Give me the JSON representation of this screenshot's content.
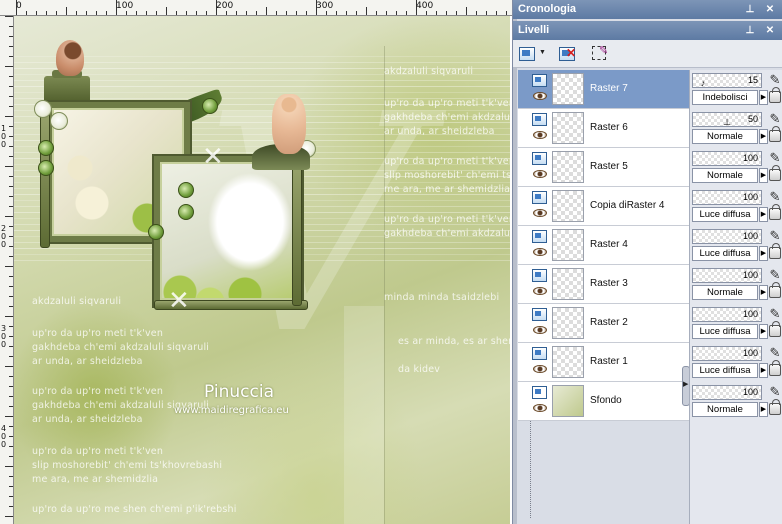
{
  "ruler_top": {
    "labels": [
      "0",
      "100",
      "200",
      "300",
      "400"
    ]
  },
  "ruler_left": {
    "labels": [
      "1",
      "0",
      "0",
      "2",
      "0",
      "0",
      "3",
      "0",
      "0",
      "4",
      "0",
      "0"
    ]
  },
  "canvas": {
    "text_lines": [
      "akdzaluli siqvaruli",
      "up'ro da up'ro meti t'k'ven",
      "gakhdeba ch'emi akdzaluli siqvaruli",
      "ar unda, ar sheidzleba",
      "up'ro da up'ro meti t'k'ven",
      "slip moshorebit' ch'emi ts'khovrebashi",
      "me ara, me ar shemidzlia",
      "da kidev",
      "up'ro da up'ro meti t'k'ven",
      "gakhdeba ch'emi akdzaluli siqvaruli",
      "minda minda tsaidzlebi",
      "es ar minda, es ar shemidzlia",
      "up'ro da up'ro meti t'k'ven",
      "slip moshorebit' ch'emi ts'khovrebashi",
      "me ara, me ar shemidzlia",
      "up'ro da up'ro me shen ch'emi p'ik'rebshi"
    ],
    "signature": "Pinuccia",
    "website": "www.maidiregrafica.eu"
  },
  "panels": {
    "history_title": "Cronologia",
    "layers_title": "Livelli"
  },
  "layers": [
    {
      "name": "Raster 7",
      "selected": true
    },
    {
      "name": "Raster 6"
    },
    {
      "name": "Raster 5"
    },
    {
      "name": "Copia diRaster 4"
    },
    {
      "name": "Raster 4"
    },
    {
      "name": "Raster 3"
    },
    {
      "name": "Raster 2"
    },
    {
      "name": "Raster 1"
    },
    {
      "name": "Sfondo"
    }
  ],
  "layer_props": [
    {
      "opacity": "15",
      "blend": "Indebolisci"
    },
    {
      "opacity": "50",
      "blend": "Normale"
    },
    {
      "opacity": "100",
      "blend": "Normale"
    },
    {
      "opacity": "100",
      "blend": "Luce diffusa"
    },
    {
      "opacity": "100",
      "blend": "Luce diffusa"
    },
    {
      "opacity": "100",
      "blend": "Normale"
    },
    {
      "opacity": "100",
      "blend": "Luce diffusa"
    },
    {
      "opacity": "100",
      "blend": "Luce diffusa"
    },
    {
      "opacity": "100",
      "blend": "Normale"
    }
  ],
  "colors": {
    "panel_title": "#5d7aa3",
    "selected_layer": "#7b9ac8"
  },
  "icons": {
    "history_pin": "pin-icon",
    "history_close": "close-icon",
    "layers_pin": "pin-icon",
    "layers_close": "close-icon",
    "new_layer": "new-layer-icon",
    "delete_layer": "delete-layer-icon",
    "mask": "mask-icon"
  }
}
